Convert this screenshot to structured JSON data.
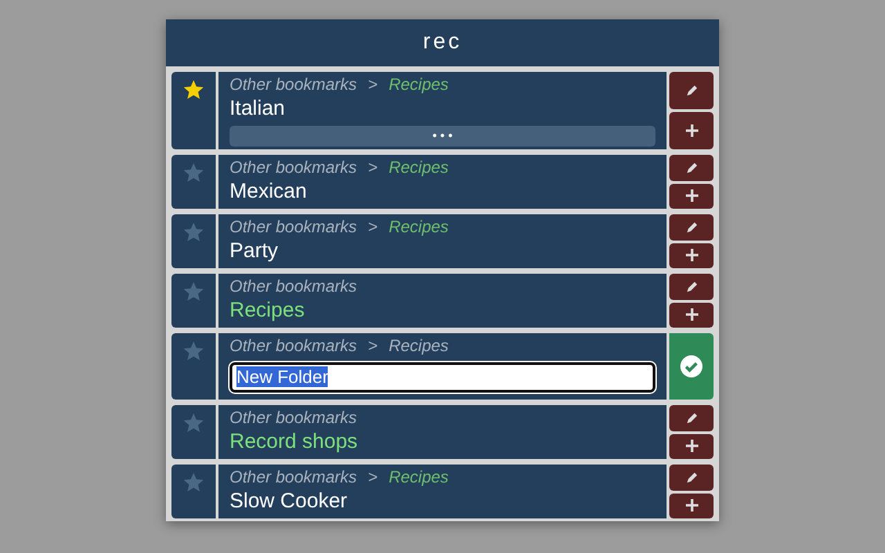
{
  "header": {
    "title": "rec"
  },
  "rows": [
    {
      "starred": true,
      "kind": "bookmark",
      "path": [
        {
          "text": "Other bookmarks",
          "kind": "crumb"
        },
        {
          "text": ">",
          "kind": "separator"
        },
        {
          "text": "Recipes",
          "kind": "folder-link"
        }
      ],
      "title": "Italian",
      "more": "• • •"
    },
    {
      "starred": false,
      "kind": "bookmark",
      "path": [
        {
          "text": "Other bookmarks",
          "kind": "crumb"
        },
        {
          "text": ">",
          "kind": "separator"
        },
        {
          "text": "Recipes",
          "kind": "folder-link"
        }
      ],
      "title": "Mexican"
    },
    {
      "starred": false,
      "kind": "bookmark",
      "path": [
        {
          "text": "Other bookmarks",
          "kind": "crumb"
        },
        {
          "text": ">",
          "kind": "separator"
        },
        {
          "text": "Recipes",
          "kind": "folder-link"
        }
      ],
      "title": "Party"
    },
    {
      "starred": false,
      "kind": "folder",
      "path": [
        {
          "text": "Other bookmarks",
          "kind": "crumb"
        }
      ],
      "title": "Recipes"
    },
    {
      "starred": false,
      "kind": "editing",
      "path": [
        {
          "text": "Other bookmarks",
          "kind": "crumb"
        },
        {
          "text": ">",
          "kind": "separator"
        },
        {
          "text": "Recipes",
          "kind": "crumb"
        }
      ],
      "value": "New Folder",
      "text_selected": true
    },
    {
      "starred": false,
      "kind": "folder",
      "path": [
        {
          "text": "Other bookmarks",
          "kind": "crumb"
        }
      ],
      "title": "Record shops"
    },
    {
      "starred": false,
      "kind": "bookmark",
      "path": [
        {
          "text": "Other bookmarks",
          "kind": "crumb"
        },
        {
          "text": ">",
          "kind": "separator"
        },
        {
          "text": "Recipes",
          "kind": "folder-link"
        }
      ],
      "title": "Slow Cooker"
    }
  ]
}
